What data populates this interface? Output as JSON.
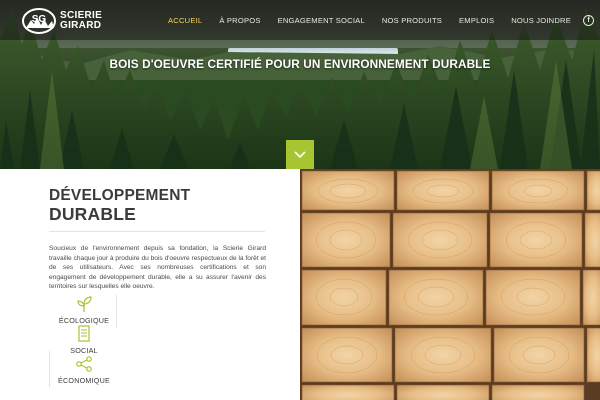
{
  "brand": {
    "initials": "SG",
    "line1": "SCIERIE",
    "line2": "GIRARD"
  },
  "nav": {
    "items": [
      {
        "label": "ACCUEIL",
        "active": true
      },
      {
        "label": "À PROPOS",
        "active": false
      },
      {
        "label": "ENGAGEMENT SOCIAL",
        "active": false
      },
      {
        "label": "NOS PRODUITS",
        "active": false
      },
      {
        "label": "EMPLOIS",
        "active": false
      },
      {
        "label": "NOUS JOINDRE",
        "active": false
      }
    ],
    "social_icon": "facebook-icon",
    "social_glyph": "f"
  },
  "hero": {
    "title": "BOIS D'OEUVRE CERTIFIÉ POUR UN ENVIRONNEMENT DURABLE",
    "scroll_icon": "chevron-down-icon"
  },
  "section": {
    "title_line1": "DÉVELOPPEMENT",
    "title_line2": "DURABLE",
    "body": "Soucieux de l'environnement depuis sa fondation, la Scierie Girard travaille chaque jour à produire du bois d'oeuvre respectueux de la forêt et de ses utilisateurs. Avec ses nombreuses certifications et son engagement de développement durable, elle a su assurer l'avenir des territoires sur lesquelles elle oeuvre.",
    "tabs": [
      {
        "label": "ÉCOLOGIQUE",
        "icon": "sprout-icon"
      },
      {
        "label": "SOCIAL",
        "icon": "document-icon"
      },
      {
        "label": "ÉCONOMIQUE",
        "icon": "share-icon"
      }
    ]
  },
  "colors": {
    "accent": "#a7c431",
    "nav_active": "#f0d35c",
    "heading": "#3b3b3b"
  }
}
